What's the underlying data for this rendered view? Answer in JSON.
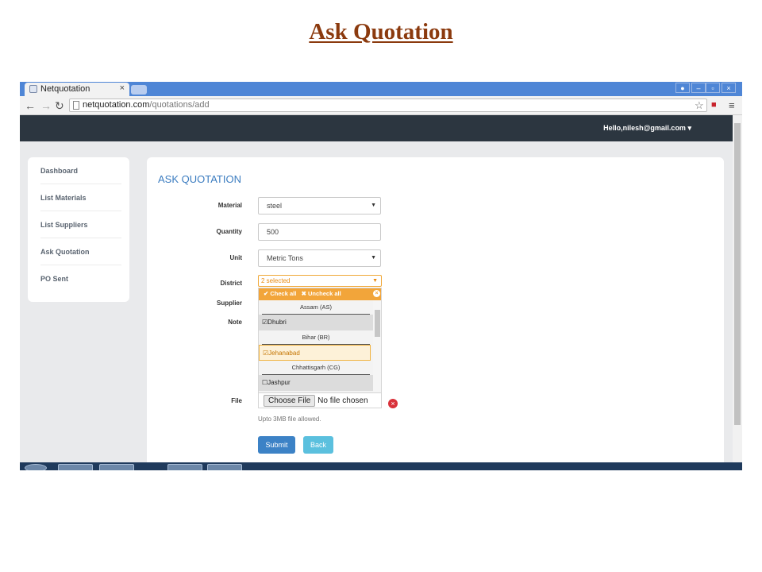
{
  "slide": {
    "title": "Ask Quotation"
  },
  "browser": {
    "tab_title": "Netquotation",
    "tab_close": "×",
    "url_host": "netquotation.com",
    "url_path": "/quotations/add"
  },
  "app": {
    "user_menu": "Hello,nilesh@gmail.com",
    "user_caret": "▾"
  },
  "sidebar": {
    "items": [
      {
        "label": "Dashboard"
      },
      {
        "label": "List Materials"
      },
      {
        "label": "List Suppliers"
      },
      {
        "label": "Ask Quotation"
      },
      {
        "label": "PO Sent"
      }
    ]
  },
  "form": {
    "heading": "ASK QUOTATION",
    "material_label": "Material",
    "material_value": "steel",
    "quantity_label": "Quantity",
    "quantity_value": "500",
    "unit_label": "Unit",
    "unit_value": "Metric Tons",
    "district_label": "District",
    "district_value": "2 selected",
    "supplier_label": "Supplier",
    "note_label": "Note",
    "file_label": "File",
    "file_button": "Choose File",
    "file_status": "No file chosen",
    "file_hint": "Upto 3MB file allowed.",
    "submit_label": "Submit",
    "back_label": "Back"
  },
  "district_dropdown": {
    "check_all": "Check all",
    "uncheck_all": "Uncheck all",
    "groups": [
      {
        "name": "Assam (AS)",
        "options": [
          {
            "label": "Dhubri",
            "checked": true
          }
        ]
      },
      {
        "name": "Bihar (BR)",
        "options": [
          {
            "label": "Jehanabad",
            "checked": true
          }
        ]
      },
      {
        "name": "Chhattisgarh (CG)",
        "options": [
          {
            "label": "Jashpur",
            "checked": false
          }
        ]
      }
    ]
  },
  "colors": {
    "appbar": "#2c3640",
    "accent_blue": "#3b7cc0",
    "dropdown_orange": "#f2a53a",
    "title_brown": "#8b3a0e"
  }
}
